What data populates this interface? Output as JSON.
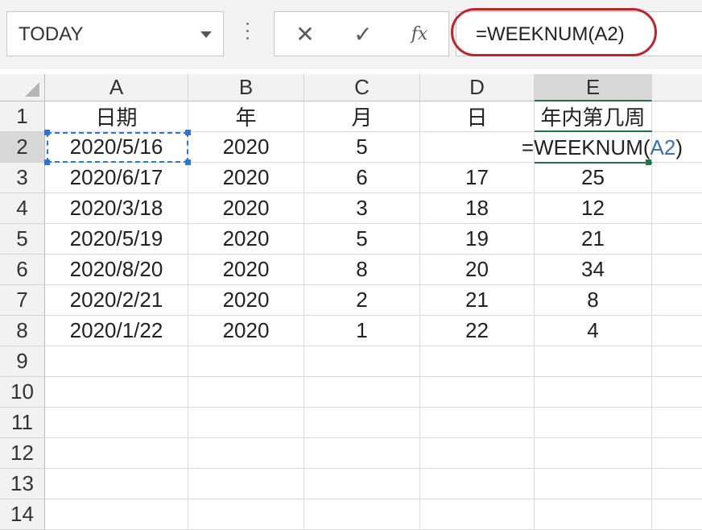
{
  "name_box": {
    "value": "TODAY"
  },
  "formula_bar": {
    "cancel_glyph": "✕",
    "enter_glyph": "✓",
    "fx_label": "fx",
    "formula": "=WEEKNUM(A2)"
  },
  "columns": [
    "A",
    "B",
    "C",
    "D",
    "E"
  ],
  "rows": [
    "1",
    "2",
    "3",
    "4",
    "5",
    "6",
    "7",
    "8",
    "9",
    "10",
    "11",
    "12",
    "13",
    "14"
  ],
  "cells": [
    [
      "日期",
      "年",
      "月",
      "日",
      "年内第几周"
    ],
    [
      "2020/5/16",
      "2020",
      "5",
      "",
      ""
    ],
    [
      "2020/6/17",
      "2020",
      "6",
      "17",
      "25"
    ],
    [
      "2020/3/18",
      "2020",
      "3",
      "18",
      "12"
    ],
    [
      "2020/5/19",
      "2020",
      "5",
      "19",
      "21"
    ],
    [
      "2020/8/20",
      "2020",
      "8",
      "20",
      "34"
    ],
    [
      "2020/2/21",
      "2020",
      "2",
      "21",
      "8"
    ],
    [
      "2020/1/22",
      "2020",
      "1",
      "22",
      "4"
    ]
  ],
  "editing_cell": {
    "prefix": "=WEEKNUM(",
    "ref": "A2",
    "suffix": ")"
  },
  "colors": {
    "highlight_ring": "#c0242a",
    "selection_green": "#217346",
    "ref_blue": "#2e75d6"
  }
}
